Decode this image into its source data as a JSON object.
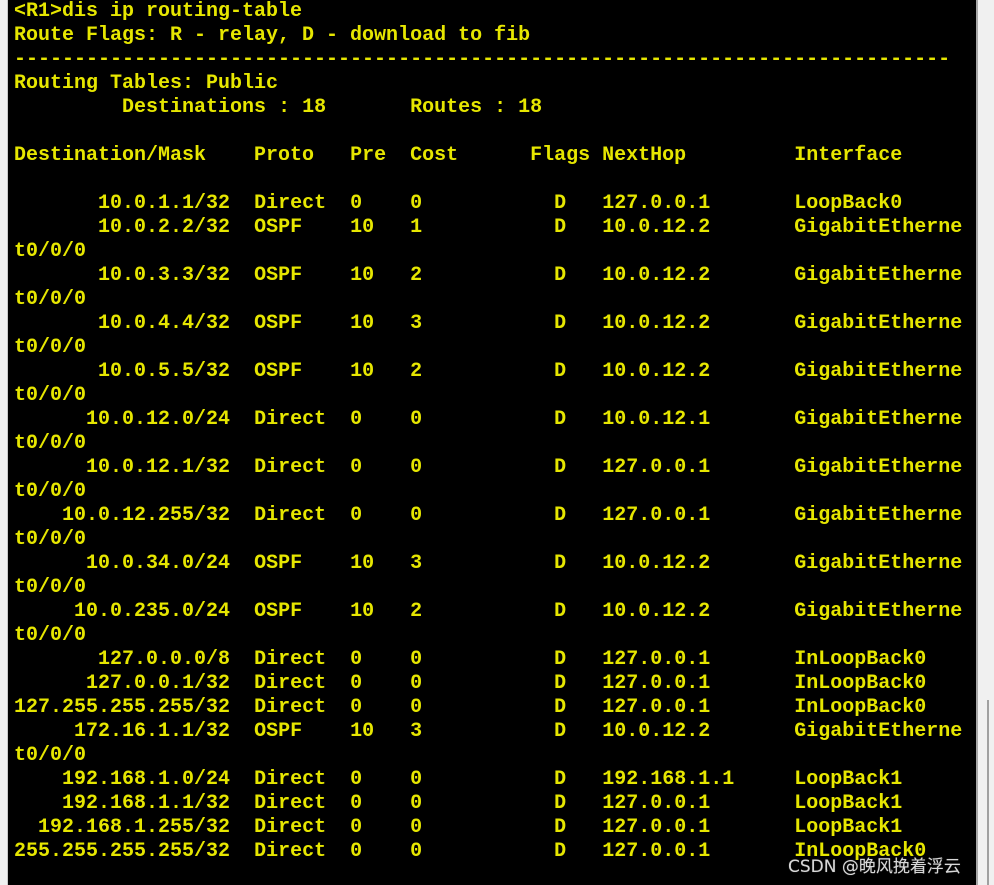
{
  "terminal": {
    "command_line": "<R1>dis ip routing-table",
    "flags_line": "Route Flags: R - relay, D - download to fib",
    "separator": "------------------------------------------------------------------------------",
    "table_title": "Routing Tables: Public",
    "destinations_label": "Destinations",
    "destinations": "18",
    "routes_label": "Routes",
    "routes_count": "18",
    "columns": [
      "Destination/Mask",
      "Proto",
      "Pre",
      "Cost",
      "Flags",
      "NextHop",
      "Interface"
    ],
    "routes": [
      [
        "10.0.1.1/32",
        "Direct",
        "0",
        "0",
        "D",
        "127.0.0.1",
        "LoopBack0"
      ],
      [
        "10.0.2.2/32",
        "OSPF",
        "10",
        "1",
        "D",
        "10.0.12.2",
        "GigabitEthernet0/0/0"
      ],
      [
        "10.0.3.3/32",
        "OSPF",
        "10",
        "2",
        "D",
        "10.0.12.2",
        "GigabitEthernet0/0/0"
      ],
      [
        "10.0.4.4/32",
        "OSPF",
        "10",
        "3",
        "D",
        "10.0.12.2",
        "GigabitEthernet0/0/0"
      ],
      [
        "10.0.5.5/32",
        "OSPF",
        "10",
        "2",
        "D",
        "10.0.12.2",
        "GigabitEthernet0/0/0"
      ],
      [
        "10.0.12.0/24",
        "Direct",
        "0",
        "0",
        "D",
        "10.0.12.1",
        "GigabitEthernet0/0/0"
      ],
      [
        "10.0.12.1/32",
        "Direct",
        "0",
        "0",
        "D",
        "127.0.0.1",
        "GigabitEthernet0/0/0"
      ],
      [
        "10.0.12.255/32",
        "Direct",
        "0",
        "0",
        "D",
        "127.0.0.1",
        "GigabitEthernet0/0/0"
      ],
      [
        "10.0.34.0/24",
        "OSPF",
        "10",
        "3",
        "D",
        "10.0.12.2",
        "GigabitEthernet0/0/0"
      ],
      [
        "10.0.235.0/24",
        "OSPF",
        "10",
        "2",
        "D",
        "10.0.12.2",
        "GigabitEthernet0/0/0"
      ],
      [
        "127.0.0.0/8",
        "Direct",
        "0",
        "0",
        "D",
        "127.0.0.1",
        "InLoopBack0"
      ],
      [
        "127.0.0.1/32",
        "Direct",
        "0",
        "0",
        "D",
        "127.0.0.1",
        "InLoopBack0"
      ],
      [
        "127.255.255.255/32",
        "Direct",
        "0",
        "0",
        "D",
        "127.0.0.1",
        "InLoopBack0"
      ],
      [
        "172.16.1.1/32",
        "OSPF",
        "10",
        "3",
        "D",
        "10.0.12.2",
        "GigabitEthernet0/0/0"
      ],
      [
        "192.168.1.0/24",
        "Direct",
        "0",
        "0",
        "D",
        "192.168.1.1",
        "LoopBack1"
      ],
      [
        "192.168.1.1/32",
        "Direct",
        "0",
        "0",
        "D",
        "127.0.0.1",
        "LoopBack1"
      ],
      [
        "192.168.1.255/32",
        "Direct",
        "0",
        "0",
        "D",
        "127.0.0.1",
        "LoopBack1"
      ],
      [
        "255.255.255.255/32",
        "Direct",
        "0",
        "0",
        "D",
        "127.0.0.1",
        "InLoopBack0"
      ]
    ],
    "text_color": "#e6e600",
    "background": "#000000"
  },
  "watermark": "CSDN @晚风挽着浮云"
}
